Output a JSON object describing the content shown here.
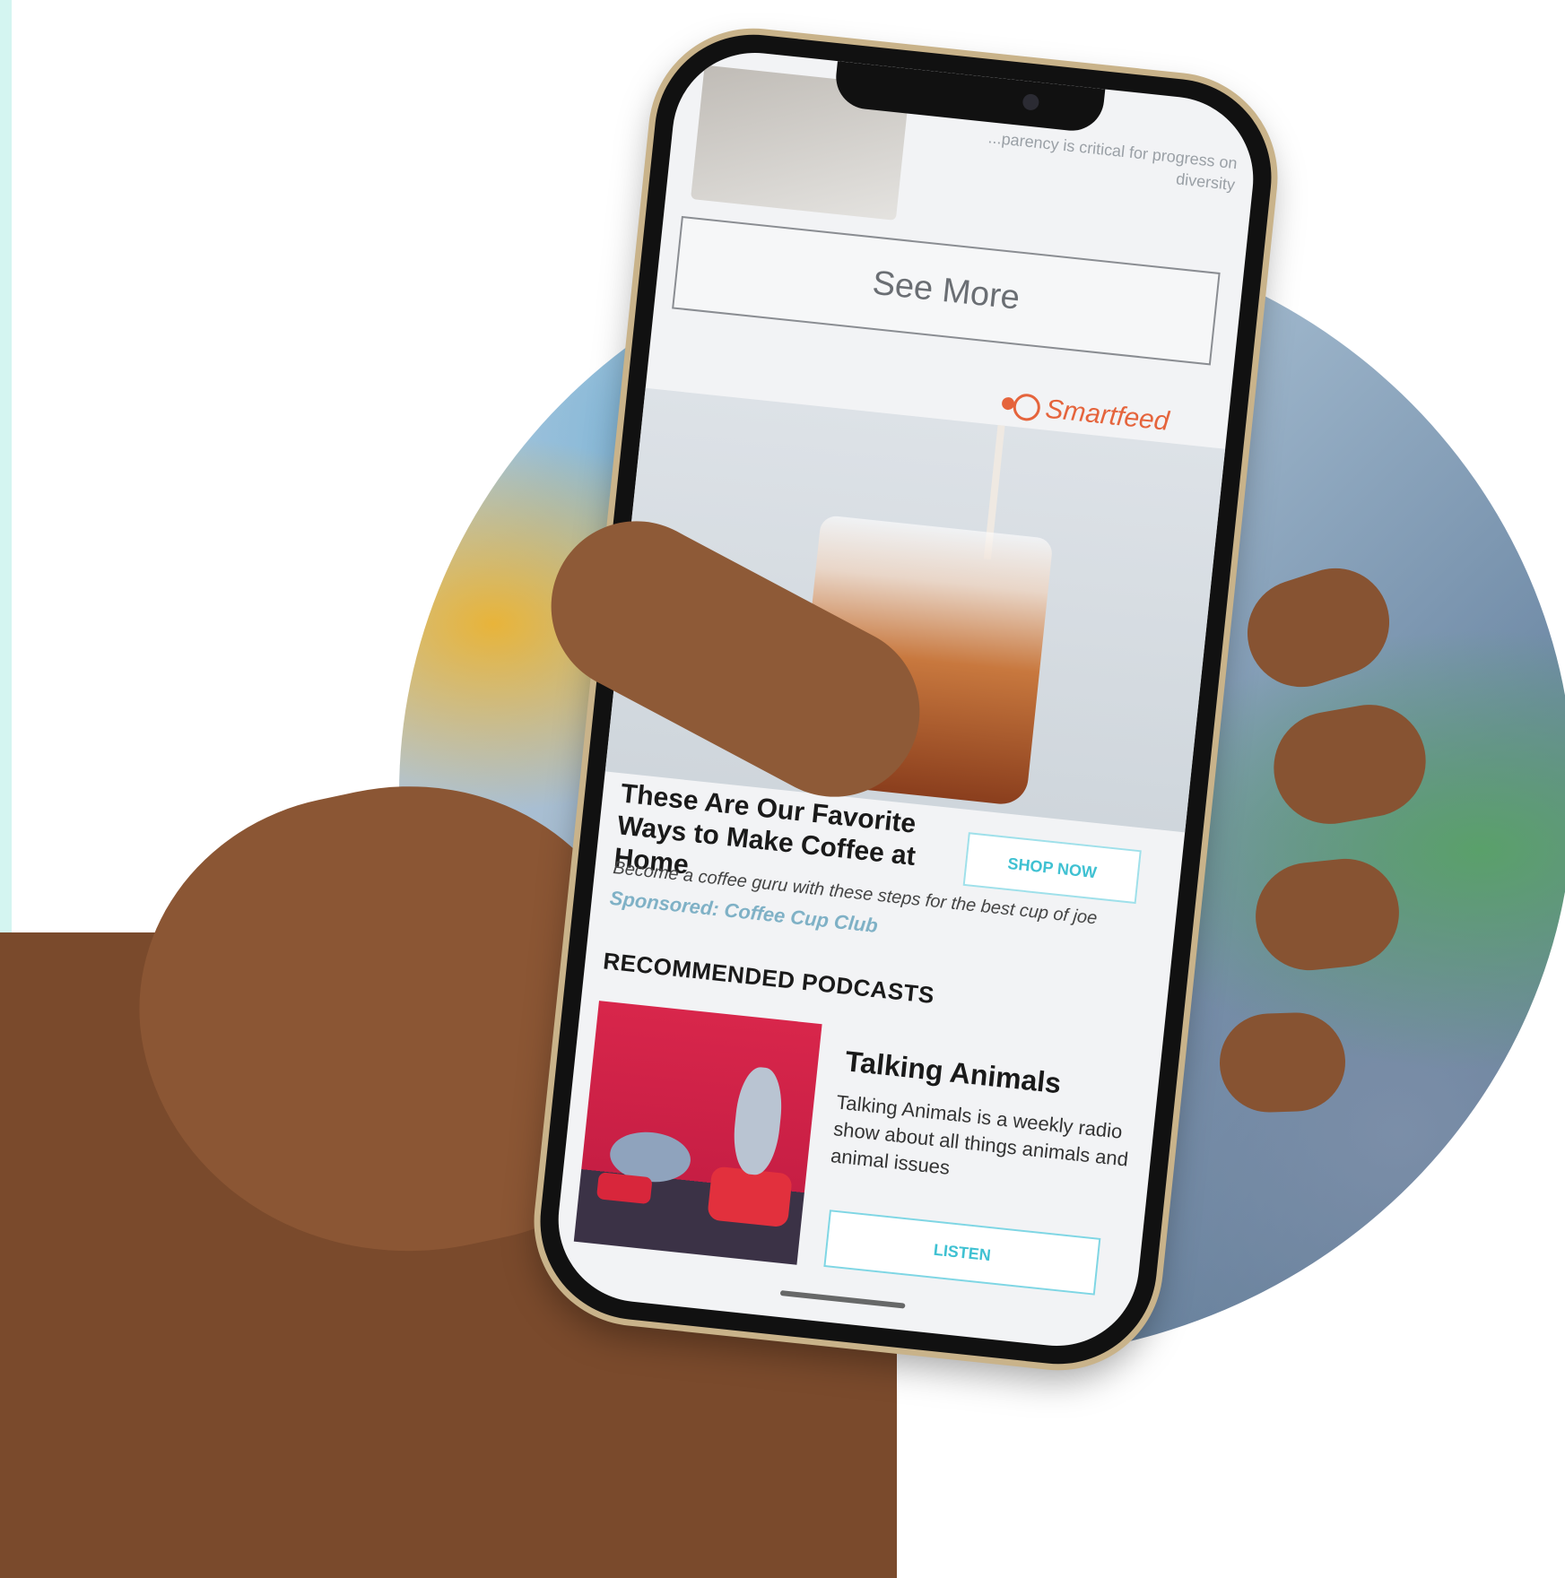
{
  "phone_screen": {
    "top_snippet": "...parency is critical for progress on diversity",
    "see_more_label": "See More",
    "smartfeed_label": "Smartfeed",
    "ad": {
      "title": "These Are Our Favorite Ways to Make Coffee at Home",
      "cta_label": "SHOP NOW",
      "description": "Become a coffee guru with these steps for the best cup of joe",
      "sponsor": "Sponsored: Coffee Cup Club"
    },
    "podcasts": {
      "section_title": "RECOMMENDED PODCASTS",
      "items": [
        {
          "title": "Talking Animals",
          "description": "Talking Animals is a weekly radio show about all things animals and animal issues",
          "cta_label": "LISTEN"
        }
      ]
    }
  },
  "colors": {
    "smartfeed_orange": "#e5643c",
    "cta_teal": "#3fc1d2",
    "podcast_red": "#d8264b",
    "edge_mint": "#d4f5f1"
  }
}
